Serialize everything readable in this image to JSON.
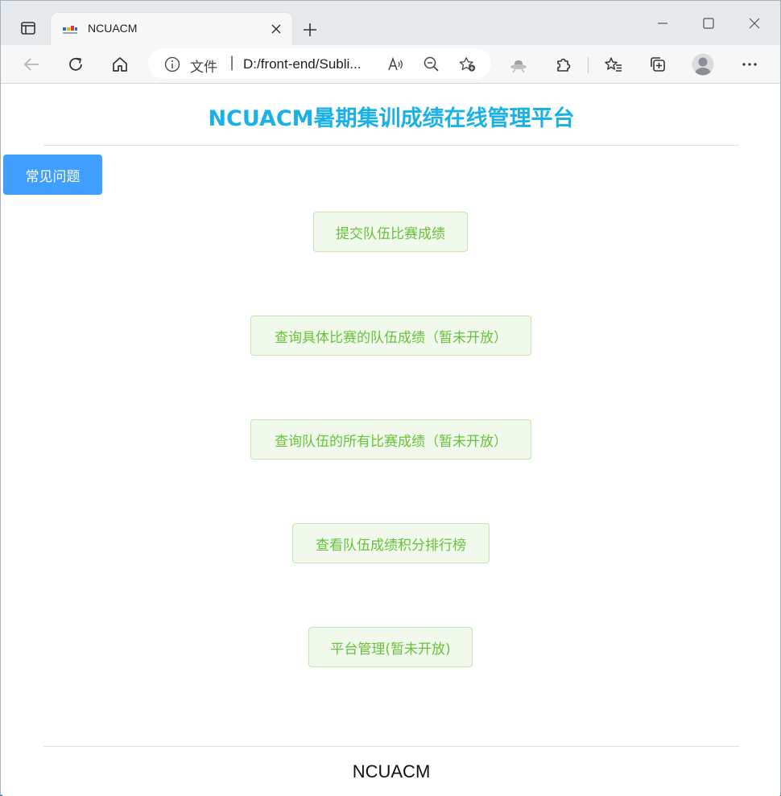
{
  "browser": {
    "tab": {
      "title": "NCUACM"
    },
    "address": {
      "scheme_label": "文件",
      "separator": "|",
      "url": "D:/front-end/Subli..."
    }
  },
  "page": {
    "title": "NCUACM暑期集训成绩在线管理平台",
    "faq_button": "常见问题",
    "actions": [
      {
        "label": "提交队伍比赛成绩"
      },
      {
        "label": "查询具体比赛的队伍成绩（暂未开放）"
      },
      {
        "label": "查询队伍的所有比赛成绩（暂未开放）"
      },
      {
        "label": "查看队伍成绩积分排行榜"
      },
      {
        "label": "平台管理(暂未开放)"
      }
    ],
    "footer": "NCUACM"
  },
  "colors": {
    "title": "#1ab1e9",
    "primary_button": "#409eff",
    "success_text": "#67c23a",
    "success_bg": "#f0f9eb",
    "success_border": "#c2e7b0"
  },
  "icons": {
    "tab_actions": "tab-actions-icon",
    "favicon": "ncuacm-favicon",
    "close": "close-icon",
    "new_tab": "plus-icon",
    "back": "back-arrow-icon",
    "refresh": "refresh-icon",
    "home": "home-icon",
    "info": "info-icon",
    "read_aloud": "read-aloud-icon",
    "zoom": "zoom-out-icon",
    "favorite_add": "add-favorite-icon",
    "extension_ufo": "extension-icon",
    "extensions": "puzzle-icon",
    "favorites": "favorites-icon",
    "collections": "collections-icon",
    "profile": "profile-avatar",
    "menu": "more-icon"
  }
}
